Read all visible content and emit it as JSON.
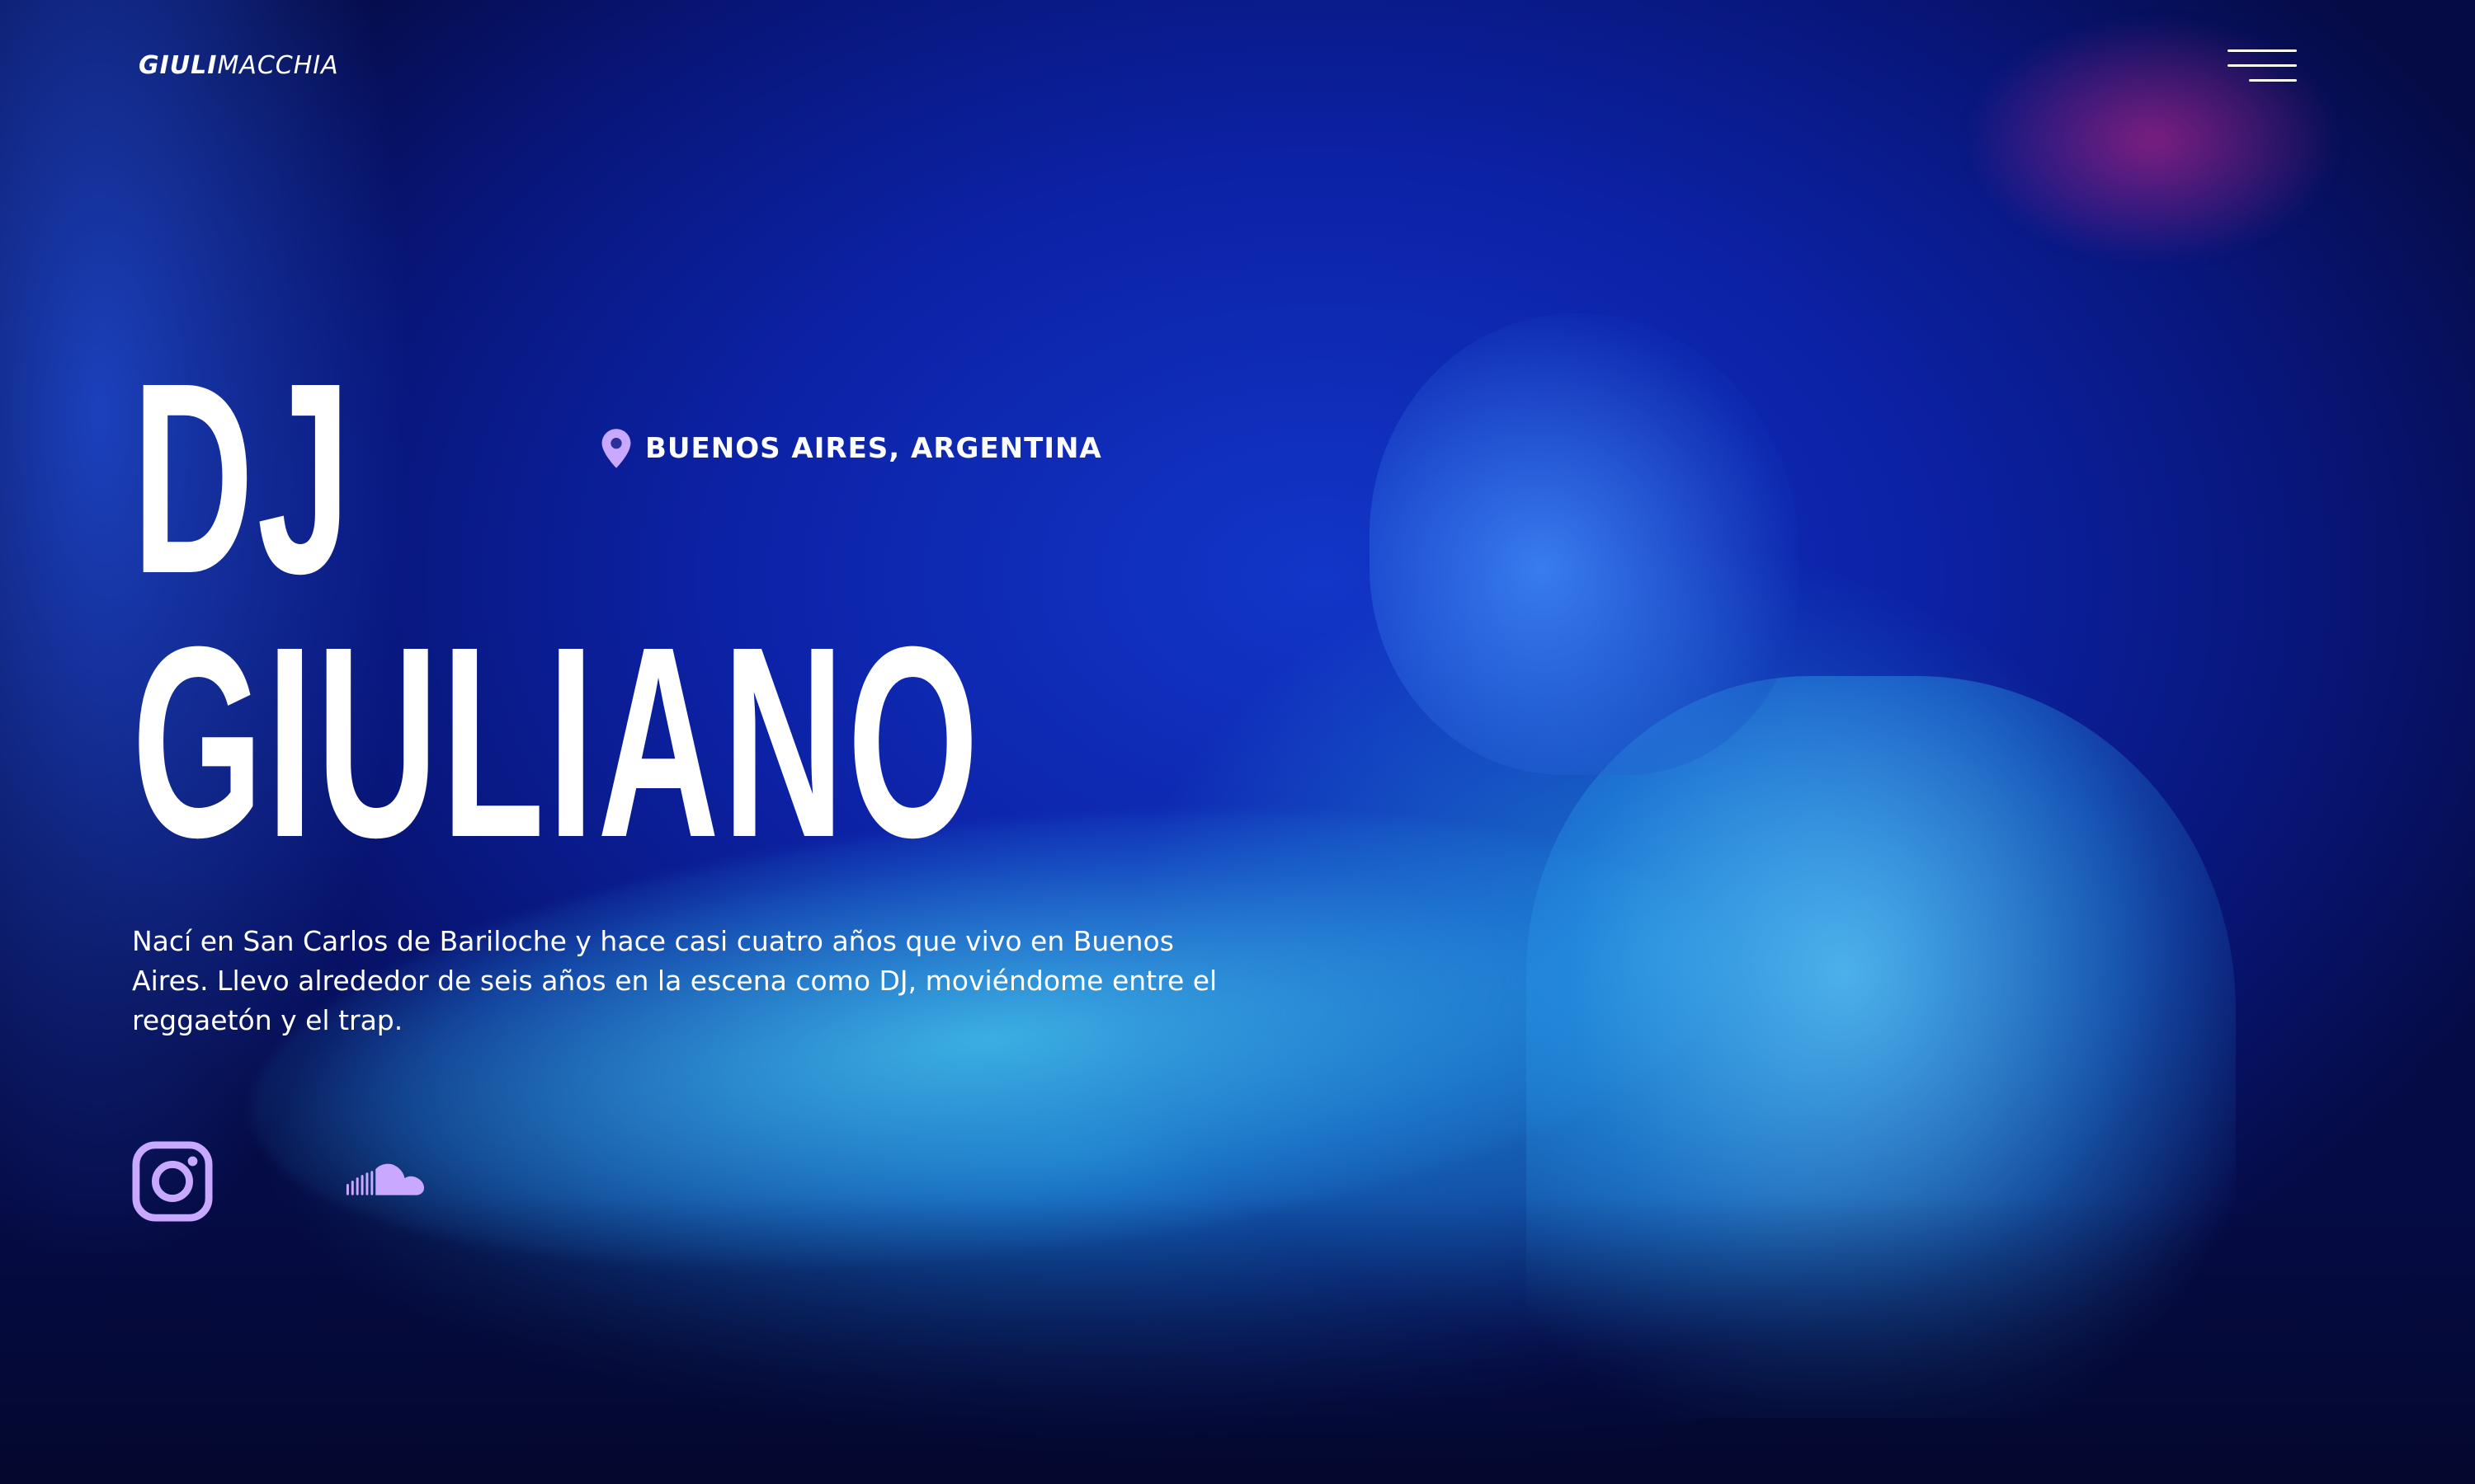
{
  "header": {
    "logo_strong": "GIULI",
    "logo_light": "MACCHIA",
    "menu_icon": "hamburger-menu-icon"
  },
  "hero": {
    "location_icon": "map-pin-icon",
    "location": "BUENOS AIRES, ARGENTINA",
    "title_line1": "DJ",
    "title_line2": "GIULIANO",
    "intro": "Nací en San Carlos de Bariloche y hace casi cuatro años que vivo en Buenos Aires. Llevo alrededor de seis años en la escena como DJ, moviéndome entre el reggaetón y el trap."
  },
  "social": [
    {
      "icon": "instagram-icon"
    },
    {
      "icon": "soundcloud-icon"
    }
  ],
  "colors": {
    "accent": "#c9a9ff",
    "text": "#ffffff",
    "background": "#0c22a6"
  }
}
